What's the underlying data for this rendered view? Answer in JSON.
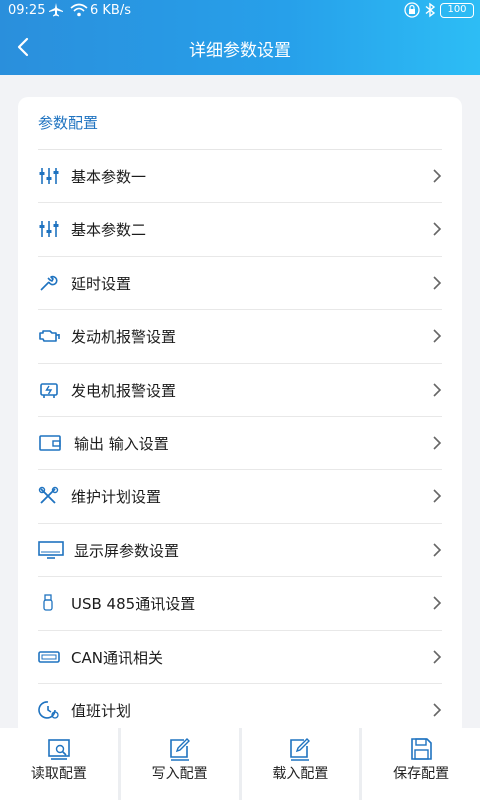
{
  "status": {
    "time": "09:25",
    "speed": "6 KB/s",
    "battery": "100"
  },
  "header": {
    "title": "详细参数设置"
  },
  "card": {
    "section_title": "参数配置"
  },
  "menu": [
    {
      "label": "基本参数一",
      "icon": "sliders-icon"
    },
    {
      "label": "基本参数二",
      "icon": "sliders-icon"
    },
    {
      "label": "延时设置",
      "icon": "wrench-icon"
    },
    {
      "label": "发动机报警设置",
      "icon": "engine-icon"
    },
    {
      "label": "发电机报警设置",
      "icon": "generator-icon"
    },
    {
      "label": "输出 输入设置",
      "icon": "io-icon"
    },
    {
      "label": "维护计划设置",
      "icon": "tools-icon"
    },
    {
      "label": "显示屏参数设置",
      "icon": "monitor-icon"
    },
    {
      "label": "USB 485通讯设置",
      "icon": "usb-icon"
    },
    {
      "label": "CAN通讯相关",
      "icon": "can-icon"
    },
    {
      "label": "值班计划",
      "icon": "schedule-icon"
    }
  ],
  "bottom": [
    {
      "label": "读取配置",
      "icon": "read-config-icon"
    },
    {
      "label": "写入配置",
      "icon": "write-config-icon"
    },
    {
      "label": "载入配置",
      "icon": "load-config-icon"
    },
    {
      "label": "保存配置",
      "icon": "save-config-icon"
    }
  ],
  "colors": {
    "accent": "#1f73c0",
    "header_start": "#2a8fdc",
    "header_end": "#2dbdf5"
  }
}
